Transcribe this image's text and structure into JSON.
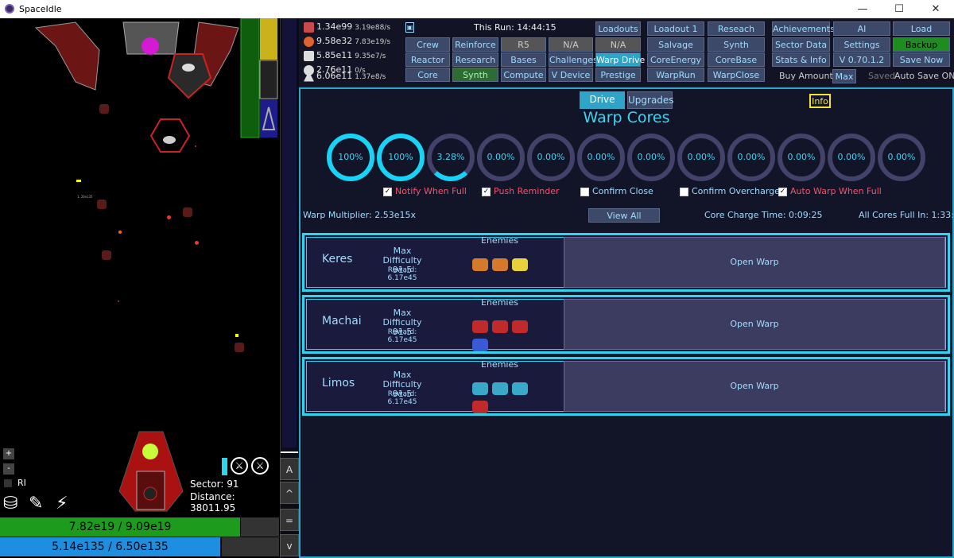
{
  "window": {
    "title": "SpaceIdle",
    "minimize": "—",
    "maximize": "☐",
    "close": "✕"
  },
  "game": {
    "boss_core_color": "#d21bd2",
    "player_hp": "7.82e19 / 9.09e19",
    "player_hp_fraction": 0.86,
    "player_shield": "5.14e135 / 6.50e135",
    "player_shield_fraction": 0.79,
    "sector": "Sector: 91",
    "distance": "Distance: 38011.95",
    "rl_label": "RI",
    "zoom_plus": "+",
    "zoom_minus": "-",
    "damage_label": "1.26e135",
    "side_buttons": [
      "A",
      "^",
      "=",
      "v"
    ]
  },
  "resources": [
    {
      "icon": "scrap-icon",
      "value": "1.34e99",
      "rate": "3.19e88/s",
      "color": "#c94a4a"
    },
    {
      "icon": "orb-icon",
      "value": "9.58e32",
      "rate": "7.83e19/s",
      "color": "#e0632e"
    },
    {
      "icon": "stack-icon",
      "value": "5.85e11",
      "rate": "9.35e7/s",
      "color": "#dddddd"
    },
    {
      "icon": "dice-icon",
      "value": "2.76e11",
      "rate": "0/s",
      "color": "#dddddd"
    },
    {
      "icon": "triangle-icon",
      "value": "6.06e11",
      "rate": "1.37e8/s",
      "color": "#dddddd"
    }
  ],
  "topbar": {
    "lock_icon": "lock-icon",
    "this_run": "This Run: 14:44:15",
    "buttons_col1": [
      "Crew",
      "Reactor",
      "Core"
    ],
    "buttons_col2": [
      "Reinforce",
      "Research",
      "Synth"
    ],
    "buttons_col3": [
      "R5",
      "Bases",
      "Compute"
    ],
    "buttons_col4": [
      "N/A",
      "Challenges",
      "V Device"
    ],
    "buttons_col5": [
      "Loadouts",
      "N/A",
      "Warp Drive",
      "Prestige"
    ],
    "buttons_col6": [
      "Loadout 1",
      "Salvage",
      "CoreEnergy",
      "WarpRun"
    ],
    "buttons_col7": [
      "Reseach",
      "Synth",
      "CoreBase",
      "WarpClose"
    ],
    "buttons_col8": [
      "Achievements",
      "Sector Data",
      "Stats & Info"
    ],
    "buttons_col9": [
      "AI",
      "Settings",
      "V 0.70.1.2"
    ],
    "buttons_col10": [
      "Load",
      "Backup",
      "Save Now"
    ],
    "buy_amount_label": "Buy Amount:",
    "buy_amount_value": "Max",
    "saved_label": "Saved",
    "auto_save": "Auto Save ON"
  },
  "warp": {
    "tabs": [
      "Drive",
      "Upgrades"
    ],
    "info_button": "Info",
    "title": "Warp Cores",
    "cores": [
      {
        "label": "100%",
        "fraction": 1.0
      },
      {
        "label": "100%",
        "fraction": 1.0
      },
      {
        "label": "3.28%",
        "fraction": 0.0328
      },
      {
        "label": "0.00%",
        "fraction": 0
      },
      {
        "label": "0.00%",
        "fraction": 0
      },
      {
        "label": "0.00%",
        "fraction": 0
      },
      {
        "label": "0.00%",
        "fraction": 0
      },
      {
        "label": "0.00%",
        "fraction": 0
      },
      {
        "label": "0.00%",
        "fraction": 0
      },
      {
        "label": "0.00%",
        "fraction": 0
      },
      {
        "label": "0.00%",
        "fraction": 0
      },
      {
        "label": "0.00%",
        "fraction": 0
      }
    ],
    "checkboxes": [
      {
        "label": "Notify When Full",
        "checked": true
      },
      {
        "label": "Push Reminder",
        "checked": true
      },
      {
        "label": "Confirm Close",
        "checked": false
      },
      {
        "label": "Confirm Overcharge",
        "checked": false
      },
      {
        "label": "Auto Warp When Full",
        "checked": true
      }
    ],
    "multiplier": "Warp Multiplier: 2.53e15x",
    "view_all": "View All",
    "core_charge_time": "Core Charge Time: 0:09:25",
    "all_cores_full": "All Cores Full In: 1:33:57",
    "enemies_label": "Enemies",
    "max_difficulty_label": "Max Difficulty",
    "open_warp": "Open Warp",
    "rows": [
      {
        "name": "Keres",
        "difficulty": "91.5",
        "reward": "Reward: 6.17e45",
        "enemy_colors": [
          "#d57a2a",
          "#d57a2a",
          "#e8d23a"
        ]
      },
      {
        "name": "Machai",
        "difficulty": "91.5",
        "reward": "Reward: 6.17e45",
        "enemy_colors": [
          "#c02a2a",
          "#c02a2a",
          "#c02a2a",
          "#3a5ad5"
        ]
      },
      {
        "name": "Limos",
        "difficulty": "91.5",
        "reward": "Reward: 6.17e45",
        "enemy_colors": [
          "#3aa9c9",
          "#3aa9c9",
          "#3aa9c9",
          "#c02a2a"
        ]
      }
    ]
  }
}
